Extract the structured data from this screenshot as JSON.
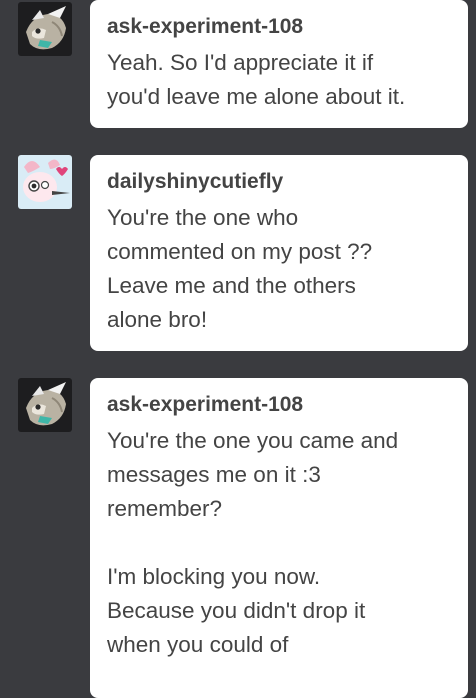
{
  "messages": [
    {
      "username": "ask-experiment-108",
      "avatar_icon": "experiment-avatar-icon",
      "text": "Yeah. So I'd appreciate it if\nyou'd leave me alone about it."
    },
    {
      "username": "dailyshinycutiefly",
      "avatar_icon": "cutiefly-avatar-icon",
      "text": "You're the one who\ncommented on my post ??\nLeave me and the others\nalone bro!"
    },
    {
      "username": "ask-experiment-108",
      "avatar_icon": "experiment-avatar-icon",
      "text": "You're the one you came and\nmessages me on it :3\nremember?\n\nI'm blocking you now.\nBecause you didn't drop it\nwhen you could of"
    }
  ],
  "colors": {
    "background": "#3a3b3f",
    "bubble": "#ffffff",
    "text": "#444444"
  }
}
